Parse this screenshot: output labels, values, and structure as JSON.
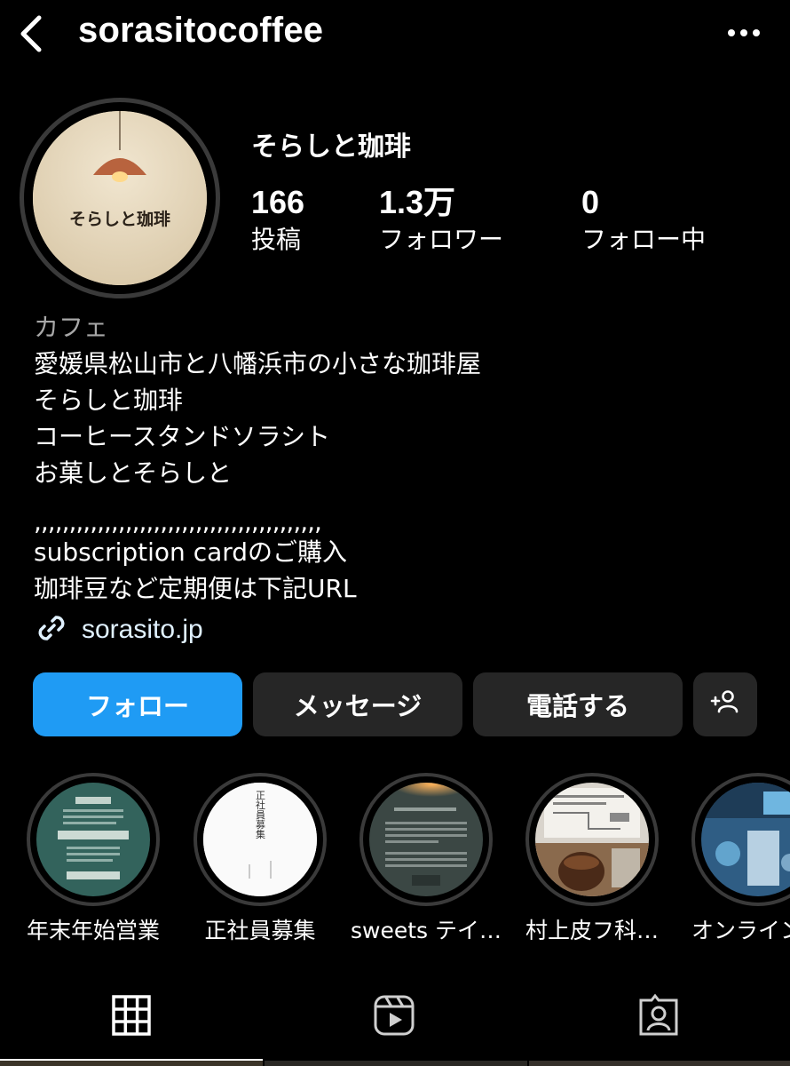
{
  "header": {
    "username": "sorasitocoffee"
  },
  "profile": {
    "display_name": "そらしと珈琲",
    "avatar_logo_text": "そらしと珈琲",
    "stats": [
      {
        "value": "166",
        "label": "投稿"
      },
      {
        "value": "1.3万",
        "label": "フォロワー"
      },
      {
        "value": "0",
        "label": "フォロー中"
      }
    ]
  },
  "bio": {
    "category": "カフェ",
    "lines": [
      "愛媛県松山市と八幡浜市の小さな珈琲屋",
      "そらしと珈琲",
      "コーヒースタンドソラシト",
      "お菓しとそらしと"
    ],
    "divider": ",,,,,,,,,,,,,,,,,,,,,,,,,,,,,,,,,,,,,,,,,",
    "lines2": [
      "subscription cardのご購入",
      "珈琲豆など定期便は下記URL"
    ],
    "link": "sorasito.jp"
  },
  "buttons": {
    "follow": "フォロー",
    "message": "メッセージ",
    "call": "電話する"
  },
  "highlights": [
    {
      "caption": "年末年始営業"
    },
    {
      "caption": "正社員募集",
      "thumb_text": "正社員募集"
    },
    {
      "caption": "sweets テイ…"
    },
    {
      "caption": "村上皮フ科…"
    },
    {
      "caption": "オンライン"
    }
  ],
  "colors": {
    "accent": "#1f9bf4",
    "button_bg": "#262626",
    "background": "#000000"
  }
}
